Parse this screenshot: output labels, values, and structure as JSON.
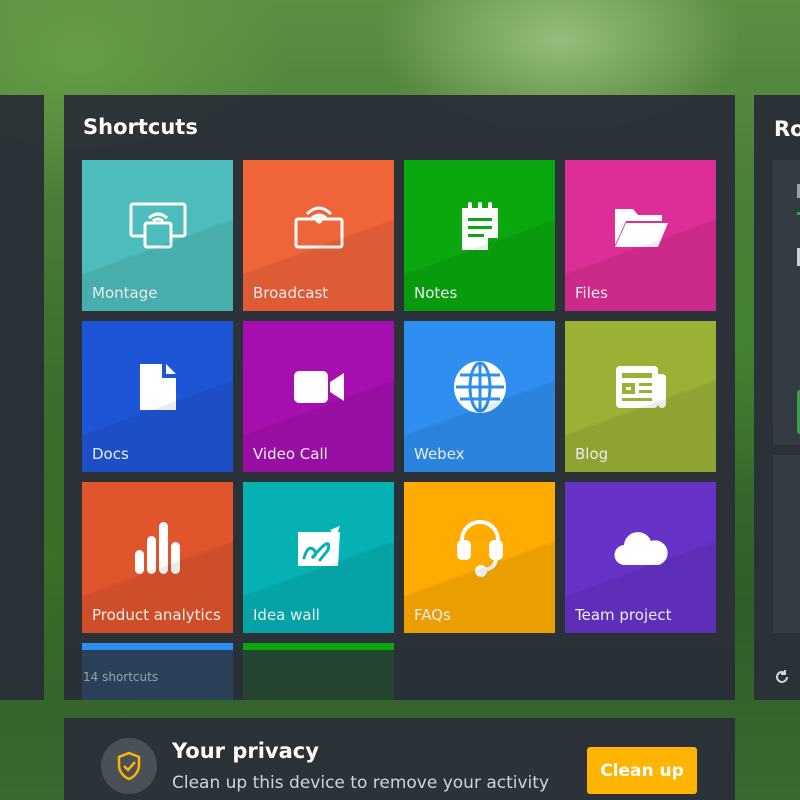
{
  "shortcuts": {
    "title": "Shortcuts",
    "count_label": "14 shortcuts",
    "tiles": [
      {
        "label": "Montage",
        "color": "#4dbcbc",
        "icon": "screen-share-icon"
      },
      {
        "label": "Broadcast",
        "color": "#f0643a",
        "icon": "broadcast-icon"
      },
      {
        "label": "Notes",
        "color": "#0aa80e",
        "icon": "notepad-icon"
      },
      {
        "label": "Files",
        "color": "#dd2d96",
        "icon": "folder-icon"
      },
      {
        "label": "Docs",
        "color": "#1e55d6",
        "icon": "document-icon"
      },
      {
        "label": "Video Call",
        "color": "#a50fb0",
        "icon": "video-camera-icon"
      },
      {
        "label": "Webex",
        "color": "#2e8ff0",
        "icon": "globe-icon"
      },
      {
        "label": "Blog",
        "color": "#9ab135",
        "icon": "newspaper-icon"
      },
      {
        "label": "Product analytics",
        "color": "#e0552c",
        "icon": "bar-chart-icon"
      },
      {
        "label": "Idea wall",
        "color": "#05b1b3",
        "icon": "whiteboard-icon"
      },
      {
        "label": "FAQs",
        "color": "#ffab00",
        "icon": "headset-icon"
      },
      {
        "label": "Team project",
        "color": "#6632c8",
        "icon": "cloud-icon"
      },
      {
        "label": "",
        "color": "#2e8ff0",
        "icon": ""
      },
      {
        "label": "",
        "color": "#0aa80e",
        "icon": "broadcast-icon"
      }
    ]
  },
  "right_panel": {
    "title_fragment": "Ro"
  },
  "privacy": {
    "title": "Your privacy",
    "text": "Clean up this device to remove your activity",
    "button_label": "Clean up",
    "icon": "shield-check-icon",
    "accent": "#ffb400"
  }
}
